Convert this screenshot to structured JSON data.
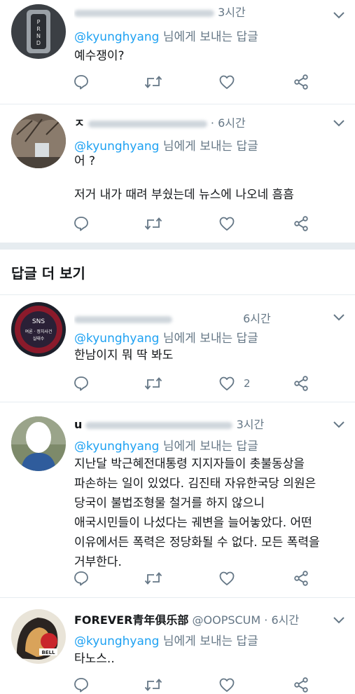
{
  "tweets": [
    {
      "time": "3시간",
      "reply_prefix": "@kyunghyang",
      "reply_suffix": " 님에게 보내는 답글",
      "lines": [
        "예수쟁이?"
      ],
      "like_count": ""
    },
    {
      "name_visible": "ㅈ",
      "time": "· 6시간",
      "reply_prefix": "@kyunghyang",
      "reply_suffix": " 님에게 보내는 답글",
      "lines": [
        "어 ?",
        "",
        "저거 내가 때려 부쉈는데 뉴스에 나오네 흠흠"
      ],
      "like_count": ""
    },
    {
      "time": "6시간",
      "reply_prefix": "@kyunghyang",
      "reply_suffix": " 님에게 보내는 답글",
      "lines": [
        "한남이지 뭐 딱 봐도"
      ],
      "like_count": "2",
      "avatar_text": [
        "SNS",
        "여론 · 정치사건",
        "실태수"
      ]
    },
    {
      "name_visible": "u",
      "time": "3시간",
      "reply_prefix": "@kyunghyang",
      "reply_suffix": " 님에게 보내는 답글",
      "lines": [
        "지난달 박근혜전대통령 지지자들이 촛불동상을",
        "파손하는 일이 있었다. 김진태 자유한국당 의원은",
        "당국이 불법조형물 철거를 하지 않으니",
        "애국시민들이 나섰다는 궤변을 늘어놓았다. 어떤",
        "이유에서든 폭력은 정당화될 수 없다. 모든 폭력을",
        "거부한다."
      ],
      "like_count": ""
    },
    {
      "name": "FOREVER青年俱乐部",
      "handle": "@OOPSCUM",
      "time": "· 6시간",
      "reply_prefix": "@kyunghyang",
      "reply_suffix": " 님에게 보내는 답글",
      "lines": [
        "타노스.."
      ],
      "like_count": "",
      "avatar_text": "BELL"
    }
  ],
  "section_title": "답글 더 보기",
  "colors": {
    "accent": "#1da1f2",
    "muted": "#657786",
    "text": "#14171a",
    "divider": "#e6ecf0"
  },
  "icons": [
    "reply-icon",
    "retweet-icon",
    "like-icon",
    "share-icon",
    "chevron-down-icon"
  ]
}
